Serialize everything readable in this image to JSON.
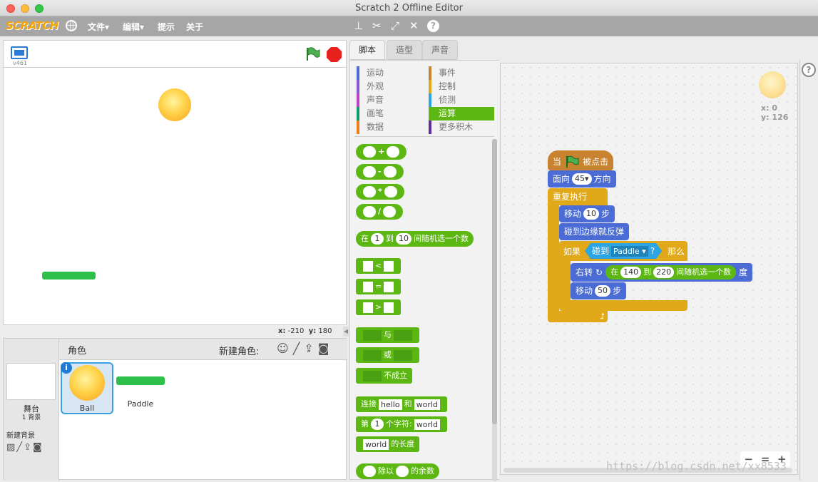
{
  "window": {
    "title": "Scratch 2 Offline Editor"
  },
  "menubar": {
    "logo": "SCRATCH",
    "items": [
      "文件▾",
      "编辑▾",
      "提示",
      "关于"
    ],
    "tool_icons": [
      "stamp-icon",
      "scissors-icon",
      "grow-icon",
      "shrink-icon",
      "help-icon"
    ]
  },
  "stage": {
    "version": "v461",
    "coords_x_label": "x:",
    "coords_x": "-210",
    "coords_y_label": "y:",
    "coords_y": "180"
  },
  "sprites": {
    "header_title": "角色",
    "new_sprite_label": "新建角色:",
    "stage_label": "舞台",
    "stage_sub": "1 背景",
    "new_backdrop_label": "新建背景",
    "items": [
      {
        "name": "Ball"
      },
      {
        "name": "Paddle"
      }
    ]
  },
  "tabs": [
    "脚本",
    "造型",
    "声音"
  ],
  "categories": {
    "left": [
      "运动",
      "外观",
      "声音",
      "画笔",
      "数据"
    ],
    "right": [
      "事件",
      "控制",
      "侦测",
      "运算",
      "更多积木"
    ],
    "left_colors": [
      "#4a6cd4",
      "#8a55d7",
      "#bb42c3",
      "#0e9a6c",
      "#ee7d16"
    ],
    "right_colors": [
      "#c88330",
      "#e1a91a",
      "#2ca5e2",
      "#5cb712",
      "#632d99"
    ]
  },
  "palette": {
    "plus": "+",
    "minus": "-",
    "times": "*",
    "divide": "/",
    "random_pre": "在",
    "random_a": "1",
    "random_to": "到",
    "random_b": "10",
    "random_post": "间随机选一个数",
    "lt": "<",
    "eq": "=",
    "gt": ">",
    "and": "与",
    "or": "或",
    "not": "不成立",
    "join_pre": "连接",
    "join_a": "hello",
    "join_and": "和",
    "join_b": "world",
    "letter_pre": "第",
    "letter_n": "1",
    "letter_mid": "个字符:",
    "letter_s": "world",
    "len_s": "world",
    "len_post": "的长度",
    "mod_mid": "除以",
    "mod_post": "的余数"
  },
  "script": {
    "hat_pre": "当",
    "hat_post": "被点击",
    "point_pre": "面向",
    "point_val": "45▾",
    "point_post": "方向",
    "forever": "重复执行",
    "move1_pre": "移动",
    "move1_val": "10",
    "move1_post": "步",
    "bounce": "碰到边缘就反弹",
    "if_pre": "如果",
    "touch_pre": "碰到",
    "touch_target": "Paddle ▾",
    "touch_q": "?",
    "if_post": "那么",
    "turn_pre": "右转",
    "rand_pre": "在",
    "rand_a": "140",
    "rand_to": "到",
    "rand_b": "220",
    "rand_post": "间随机选一个数",
    "turn_post": "度",
    "move2_pre": "移动",
    "move2_val": "50",
    "move2_post": "步"
  },
  "sprite_info": {
    "x_label": "x:",
    "x": "0",
    "y_label": "y:",
    "y": "126"
  },
  "zoom": {
    "out": "−",
    "reset": "=",
    "in": "+"
  },
  "watermark": "https://blog.csdn.net/xx8533"
}
